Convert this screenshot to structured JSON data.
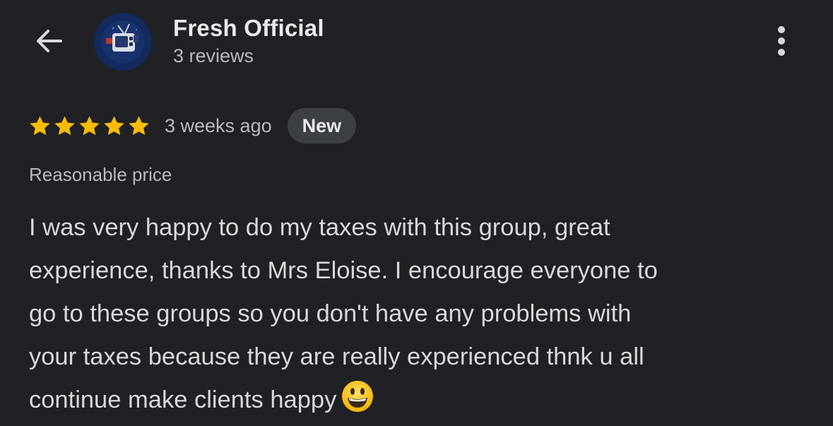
{
  "header": {
    "account_name": "Fresh Official",
    "review_count": "3 reviews",
    "back_icon": "arrow-left-icon",
    "more_icon": "more-vertical-icon"
  },
  "review": {
    "rating": 5,
    "rating_max": 5,
    "time_ago": "3 weeks ago",
    "badge": "New",
    "attribute": "Reasonable price",
    "lines": [
      "I was very happy to do my taxes with this group, great",
      "experience, thanks to Mrs Eloise. I encourage everyone to",
      "go to these groups so you don't have any problems with",
      "your taxes because they are really experienced thnk u all",
      "continue make clients happy"
    ],
    "emoji": "grinning-face-emoji"
  },
  "colors": {
    "background": "#202124",
    "star": "#fbbc04",
    "badge_bg": "#3c4043",
    "primary_text": "#e8eaed",
    "secondary_text": "#b8bbbf"
  }
}
